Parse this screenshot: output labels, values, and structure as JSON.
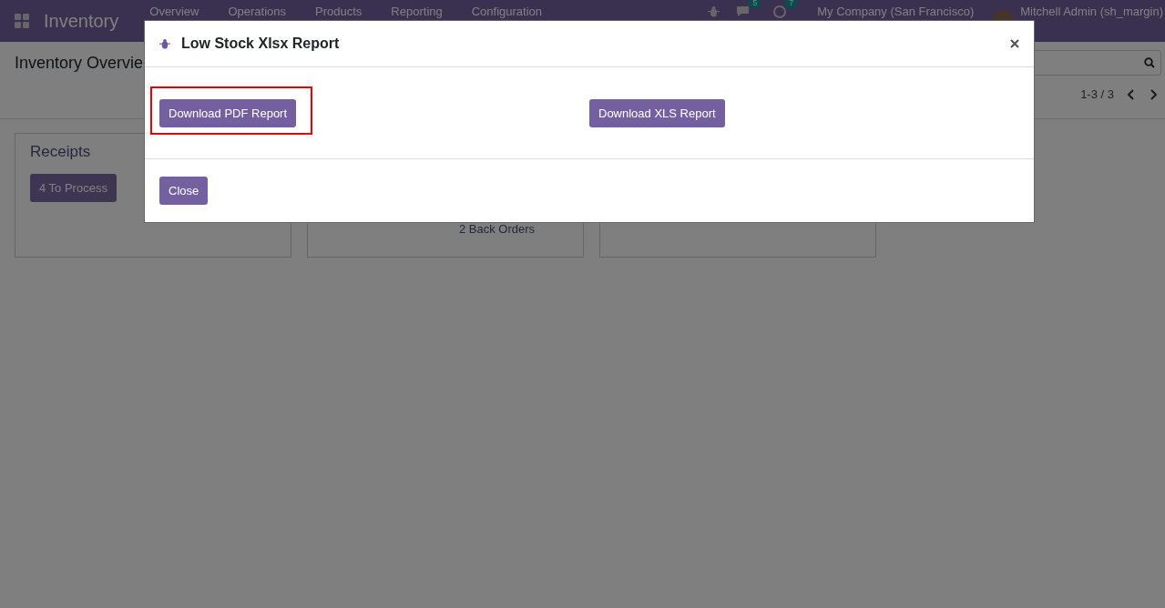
{
  "navbar": {
    "app_title": "Inventory",
    "menu": [
      {
        "label": "Overview"
      },
      {
        "label": "Operations"
      },
      {
        "label": "Products"
      },
      {
        "label": "Reporting"
      },
      {
        "label": "Configuration"
      }
    ],
    "messages_badge": "5",
    "activities_badge": "7",
    "company": "My Company (San Francisco)",
    "user": "Mitchell Admin (sh_margin)"
  },
  "control_panel": {
    "breadcrumb": "Inventory Overvie",
    "pager": "1-3 / 3"
  },
  "cards": [
    {
      "title": "Receipts",
      "action": "4 To Process"
    },
    {
      "link": "2 Back Orders"
    }
  ],
  "dialog": {
    "title": "Low Stock Xlsx Report",
    "buttons": [
      {
        "label": "Download PDF Report",
        "highlighted": true
      },
      {
        "label": "Download XLS Report",
        "highlighted": false
      }
    ],
    "footer_button": "Close"
  }
}
